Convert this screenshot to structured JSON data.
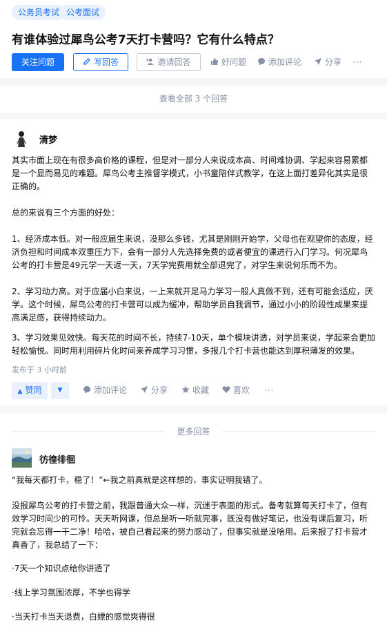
{
  "topics": [
    "公务员考试",
    "公考面试"
  ],
  "question": {
    "title": "有谁体验过犀鸟公考7天打卡营吗？它有什么特点？",
    "follow_label": "关注问题",
    "write_label": "写回答",
    "invite_label": "邀请回答",
    "good_label": "好问题",
    "comment_label": "添加评论",
    "share_label": "分享",
    "more_label": "···"
  },
  "view_all": "查看全部 3 个回答",
  "answer1": {
    "author": "清梦",
    "paragraphs": [
      "其实市面上现在有很多高价格的课程，但是对一部分人来说成本高、时间难协调、学起来容易累都是一个显而易见的难题。犀鸟公考主推督学模式，小书童陪伴式教学，在这上面打差异化其实是很正确的。",
      "总的来说有三个方面的好处：",
      "1、经济成本低。对一般应届生来说，没那么多钱，尤其是刚刚开始学，父母也在观望你的态度，经济负担和时间成本双重压力下，会有一部分人先选择免费的或者便宜的课进行入门学习。何况犀鸟公考的打卡营是49元学一天返一天，7天学完费用就全部退完了，对学生来说何乐而不为。",
      "2、学习动力高。对于应届小白来说，一上来就开足马力学习一般人真做不到，还有可能会适应，厌学。这个时候，犀鸟公考的打卡营可以成为缓冲，帮助学员自我调节，通过小小的阶段性成果来提高满足感，获得持续动力。",
      "3、学习效果见效快。每天花的时间不长，持续7-10天，单个模块讲透，对学员来说，学起来会更加轻松愉悦。同时用利用碎片化时间来养成学习习惯，多报几个打卡营也能达到厚积薄发的效果。"
    ],
    "meta": "发布于 3 小时前",
    "vote_label": "赞同",
    "comment_label": "添加评论",
    "share_label": "分享",
    "collect_label": "收藏",
    "like_label": "喜欢",
    "more_label": "···"
  },
  "more_answers": "更多回答",
  "answer2": {
    "author": "彷徨徘徊",
    "paragraphs": [
      "“我每天都打卡，稳了！”←我之前真就是这样想的，事实证明我错了。",
      "没报犀鸟公考的打卡营之前，我跟普通大众一样，沉迷于表面的形式。备考就算每天打卡了，但有效学习时间少的可怜。天天听网课，但总是听一听就完事，既没有做好笔记，也没有课后复习，听完就会忘得一干二净！哈哈，被自己看起来的努力感动了，但事实就是没啥用。后来报了打卡营才真香了，我总结了一下：",
      "·7天一个知识点给你讲透了",
      "·线上学习氛围浓厚，不学也得学",
      "·当天打卡当天退费，白嫖的感觉爽得很"
    ]
  },
  "colors": {
    "accent": "#1772f6",
    "muted": "#8590a6",
    "chip_bg": "#ebf1fc"
  }
}
